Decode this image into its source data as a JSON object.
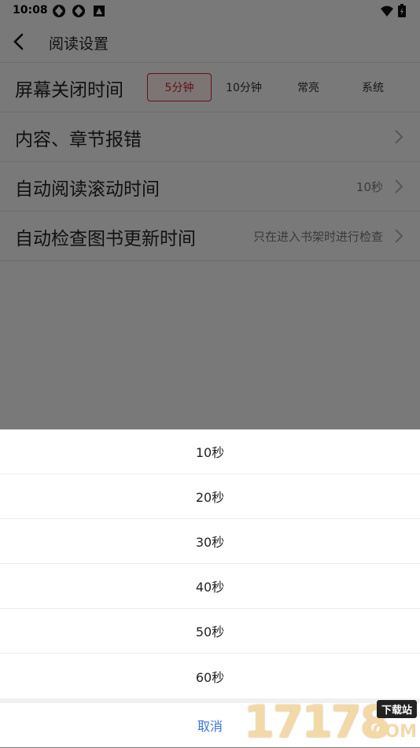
{
  "status_bar": {
    "time": "10:08",
    "icons": [
      "sync-icon",
      "sync-icon",
      "notification-icon"
    ],
    "right_icons": [
      "wifi-icon",
      "battery-icon"
    ]
  },
  "app_bar": {
    "title": "阅读设置"
  },
  "settings": {
    "screen_off": {
      "label": "屏幕关闭时间",
      "options": [
        "5分钟",
        "10分钟",
        "常亮",
        "系统"
      ],
      "selected": "5分钟"
    },
    "content_report": {
      "label": "内容、章节报错"
    },
    "auto_scroll": {
      "label": "自动阅读滚动时间",
      "value": "10秒"
    },
    "auto_check": {
      "label": "自动检查图书更新时间",
      "value": "只在进入书架时进行检查"
    }
  },
  "sheet": {
    "options": [
      "10秒",
      "20秒",
      "30秒",
      "40秒",
      "50秒",
      "60秒"
    ],
    "cancel_label": "取消"
  },
  "watermark": {
    "number": "17178",
    "badge": "下载站",
    "suffix": "COM"
  },
  "colors": {
    "accent": "#c62828",
    "cancel": "#3b73d9"
  }
}
